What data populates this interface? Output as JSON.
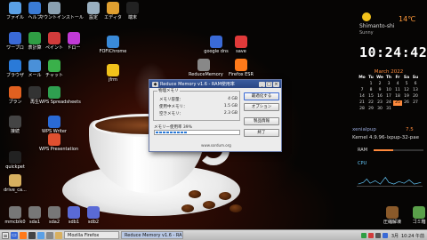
{
  "desktop": {
    "icons_left": [
      {
        "label": "ファイル",
        "icon": "folder-icon",
        "color": "#5aa0e6"
      },
      {
        "label": "ヘルプ",
        "icon": "help-icon",
        "color": "#3a7bd5"
      },
      {
        "label": "マウントインストール",
        "icon": "drive-mount-icon",
        "color": "#8aa0b0"
      },
      {
        "label": "設定",
        "icon": "settings-icon",
        "color": "#9ab0c0"
      },
      {
        "label": "エディタ",
        "icon": "editor-icon",
        "color": "#e0a030"
      },
      {
        "label": "端末",
        "icon": "terminal-icon",
        "color": "#222"
      },
      {
        "label": "ワープロ",
        "icon": "word-processor-icon",
        "color": "#3a6ad6"
      },
      {
        "label": "表計算",
        "icon": "spreadsheet-icon",
        "color": "#2f9e44"
      },
      {
        "label": "ペイント",
        "icon": "paint-icon",
        "color": "#d13b3b"
      },
      {
        "label": "ドロー",
        "icon": "draw-icon",
        "color": "#c03ad6"
      },
      {
        "label": "ブラウザ",
        "icon": "browser-icon",
        "color": "#2a7ad8"
      },
      {
        "label": "メール",
        "icon": "mail-icon",
        "color": "#4a90d8"
      },
      {
        "label": "チャット",
        "icon": "chat-icon",
        "color": "#3ab04a"
      },
      {
        "label": "プラン",
        "icon": "plan-icon",
        "color": "#e06020"
      },
      {
        "label": "再生",
        "icon": "play-icon",
        "color": "#333"
      },
      {
        "label": "WPS Spreadsheets",
        "icon": "wps-spreadsheets-icon",
        "color": "#2fa050"
      },
      {
        "label": "接続",
        "icon": "connect-icon",
        "color": "#444"
      },
      {
        "label": "WPS Writer",
        "icon": "wps-writer-icon",
        "color": "#2a6ad6"
      },
      {
        "label": "WPS Presentation",
        "icon": "wps-presentation-icon",
        "color": "#e05030"
      },
      {
        "label": "quickpet",
        "icon": "quickpet-icon",
        "color": "#222"
      },
      {
        "label": "drive_ca...",
        "icon": "drive-folder-icon",
        "color": "#d8b060"
      },
      {
        "label": "mmcblk0",
        "icon": "drive-icon",
        "color": "#777"
      },
      {
        "label": "sda1",
        "icon": "drive-icon",
        "color": "#777"
      },
      {
        "label": "sda2",
        "icon": "drive-icon",
        "color": "#777"
      },
      {
        "label": "sdb1",
        "icon": "usb-drive-icon",
        "color": "#5a6ad6"
      },
      {
        "label": "sdb2",
        "icon": "usb-drive-icon",
        "color": "#5a6ad6"
      }
    ],
    "icons_center": [
      {
        "label": "FOFIChrome",
        "icon": "chrome-app-icon",
        "color": "#3a8ad8"
      },
      {
        "label": "jfrm",
        "icon": "pacman-icon",
        "color": "#f2c21b"
      },
      {
        "label": "google dns",
        "icon": "dns-icon",
        "color": "#3a6ad6"
      },
      {
        "label": "save",
        "icon": "save-icon",
        "color": "#e03a3a"
      },
      {
        "label": "ReduceMemory",
        "icon": "reduce-memory-icon",
        "color": "#888"
      },
      {
        "label": "Firefox ESR",
        "icon": "firefox-icon",
        "color": "#ff7a1a"
      }
    ],
    "icons_right": [
      {
        "label": "圧縮解凍",
        "icon": "archive-icon",
        "color": "#8a5a2a"
      },
      {
        "label": "ゴミ箱",
        "icon": "trash-icon",
        "color": "#5aa04a"
      }
    ]
  },
  "weather": {
    "city": "Shimanto-shi",
    "condition": "Sunny",
    "temp": "14℃"
  },
  "clock": "10:24:42",
  "calendar": {
    "month_label": "March 2022",
    "headers": [
      "Mo",
      "Tu",
      "We",
      "Th",
      "Fr",
      "Sa",
      "Su"
    ],
    "rows": [
      [
        "",
        "1",
        "2",
        "3",
        "4",
        "5",
        "6"
      ],
      [
        "7",
        "8",
        "9",
        "10",
        "11",
        "12",
        "13"
      ],
      [
        "14",
        "15",
        "16",
        "17",
        "18",
        "19",
        "20"
      ],
      [
        "21",
        "22",
        "23",
        "24",
        "25",
        "26",
        "27"
      ],
      [
        "28",
        "29",
        "30",
        "31",
        "",
        "",
        ""
      ]
    ],
    "today": "25"
  },
  "sysinfo": {
    "distro": "xenialpup",
    "version": "7.5",
    "kernel": "Kernel 4.9.96-lxpup-32-pae",
    "ram_label": "RAM",
    "ram_fraction": 0.39,
    "cpu_label": "CPU"
  },
  "dialog": {
    "title": "Reduce Memory v1.6 - RAM使用率",
    "group_title": "物理メモリ",
    "rows": [
      {
        "label": "メモリ容量：",
        "value": "4 GB"
      },
      {
        "label": "使用中メモリ：",
        "value": "1.5 GB"
      },
      {
        "label": "空きメモリ：",
        "value": "2.3 GB"
      }
    ],
    "usage_label": "メモリー使用率 39%",
    "usage_percent": 39,
    "buttons": [
      "最適化する",
      "オプション",
      "製品情報",
      "終了"
    ],
    "url": "www.sordum.org"
  },
  "taskbar": {
    "tasks": [
      {
        "label": "Mozilla Firefox",
        "active": false
      },
      {
        "label": "Reduce Memory v1.6 - RA",
        "active": true
      }
    ],
    "tray_date": "3月",
    "tray_time": "10:24 午前"
  }
}
